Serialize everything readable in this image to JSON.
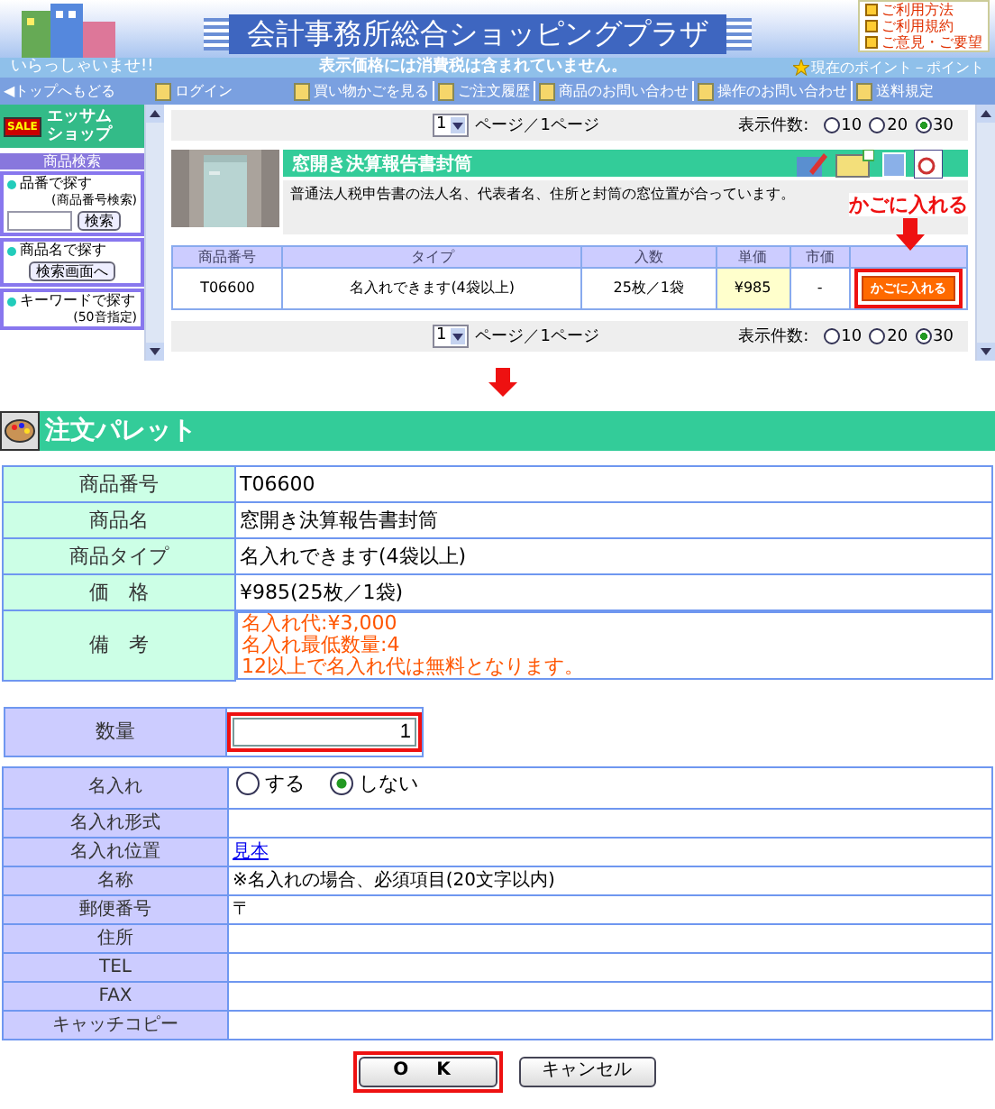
{
  "header": {
    "title": "会計事務所総合ショッピングプラザ",
    "links": [
      "ご利用方法",
      "ご利用規約",
      "ご意見・ご要望"
    ]
  },
  "info_bar": {
    "greeting": "いらっしゃいませ!!",
    "notice": "表示価格には消費税は含まれていません。",
    "points": "現在のポイント－ポイント"
  },
  "nav": {
    "back": "◀トップへもどる",
    "items": [
      "ログイン",
      "買い物かごを見る",
      "ご注文履歴",
      "商品のお問い合わせ",
      "操作のお問い合わせ",
      "送料規定"
    ]
  },
  "sidebar": {
    "sale": "SALE",
    "shop": "エッサムショップ",
    "search_title": "商品検索",
    "sections": [
      {
        "kind": "field",
        "label": "品番で探す",
        "sub": "(商品番号検索)",
        "button": "検索"
      },
      {
        "kind": "button",
        "label": "商品名で探す",
        "button": "検索画面へ"
      },
      {
        "kind": "plain",
        "label": "キーワードで探す",
        "sub": "(50音指定)"
      }
    ]
  },
  "pagers": [
    {
      "page": "1",
      "text": "ページ／1ページ",
      "per_page_label": "表示件数:",
      "options": [
        {
          "label": "10",
          "selected": false
        },
        {
          "label": "20",
          "selected": false
        },
        {
          "label": "30",
          "selected": true
        }
      ]
    },
    {
      "page": "1",
      "text": "ページ／1ページ",
      "per_page_label": "表示件数:",
      "options": [
        {
          "label": "10",
          "selected": false
        },
        {
          "label": "20",
          "selected": false
        },
        {
          "label": "30",
          "selected": true
        }
      ]
    }
  ],
  "product": {
    "name": "窓開き決算報告書封筒",
    "description": "普通法人税申告書の法人名、代表者名、住所と封筒の窓位置が合っています。",
    "columns": [
      "商品番号",
      "タイプ",
      "入数",
      "単価",
      "市価"
    ],
    "row": [
      "T06600",
      "名入れできます(4袋以上)",
      "25枚／1袋",
      "¥985",
      "-"
    ],
    "cart_button": {
      "label": "かごに入れる",
      "highlighted": true
    },
    "callout": "かごに入れる"
  },
  "palette": {
    "title": "注文パレット",
    "details": [
      {
        "kind": "text",
        "label": "商品番号",
        "value": "T06600"
      },
      {
        "kind": "text",
        "label": "商品名",
        "value": "窓開き決算報告書封筒"
      },
      {
        "kind": "text",
        "label": "商品タイプ",
        "value": "名入れできます(4袋以上)"
      },
      {
        "kind": "text",
        "label": "価　格",
        "value": "¥985(25枚／1袋)"
      },
      {
        "kind": "note",
        "label": "備　考",
        "lines": [
          "名入れ代:¥3,000",
          "名入れ最低数量:4",
          "12以上で名入れ代は無料となります。"
        ]
      }
    ]
  },
  "quantity": {
    "label": "数量",
    "value": "1",
    "highlighted": true
  },
  "name_form": [
    {
      "kind": "radio",
      "label": "名入れ",
      "options": [
        {
          "label": "する",
          "selected": false
        },
        {
          "label": "しない",
          "selected": true
        }
      ]
    },
    {
      "kind": "text",
      "label": "名入れ形式"
    },
    {
      "kind": "link",
      "label": "名入れ位置",
      "value": "見本"
    },
    {
      "kind": "text",
      "label": "名称",
      "value": "※名入れの場合、必須項目(20文字以内)"
    },
    {
      "kind": "text",
      "label": "郵便番号",
      "value": "〒"
    },
    {
      "kind": "text",
      "label": "住所"
    },
    {
      "kind": "text",
      "label": "TEL"
    },
    {
      "kind": "text",
      "label": "FAX"
    },
    {
      "kind": "text",
      "label": "キャッチコピー"
    }
  ],
  "buttons": [
    {
      "label": "O K",
      "highlighted": true
    },
    {
      "label": "キャンセル",
      "highlighted": false
    }
  ]
}
